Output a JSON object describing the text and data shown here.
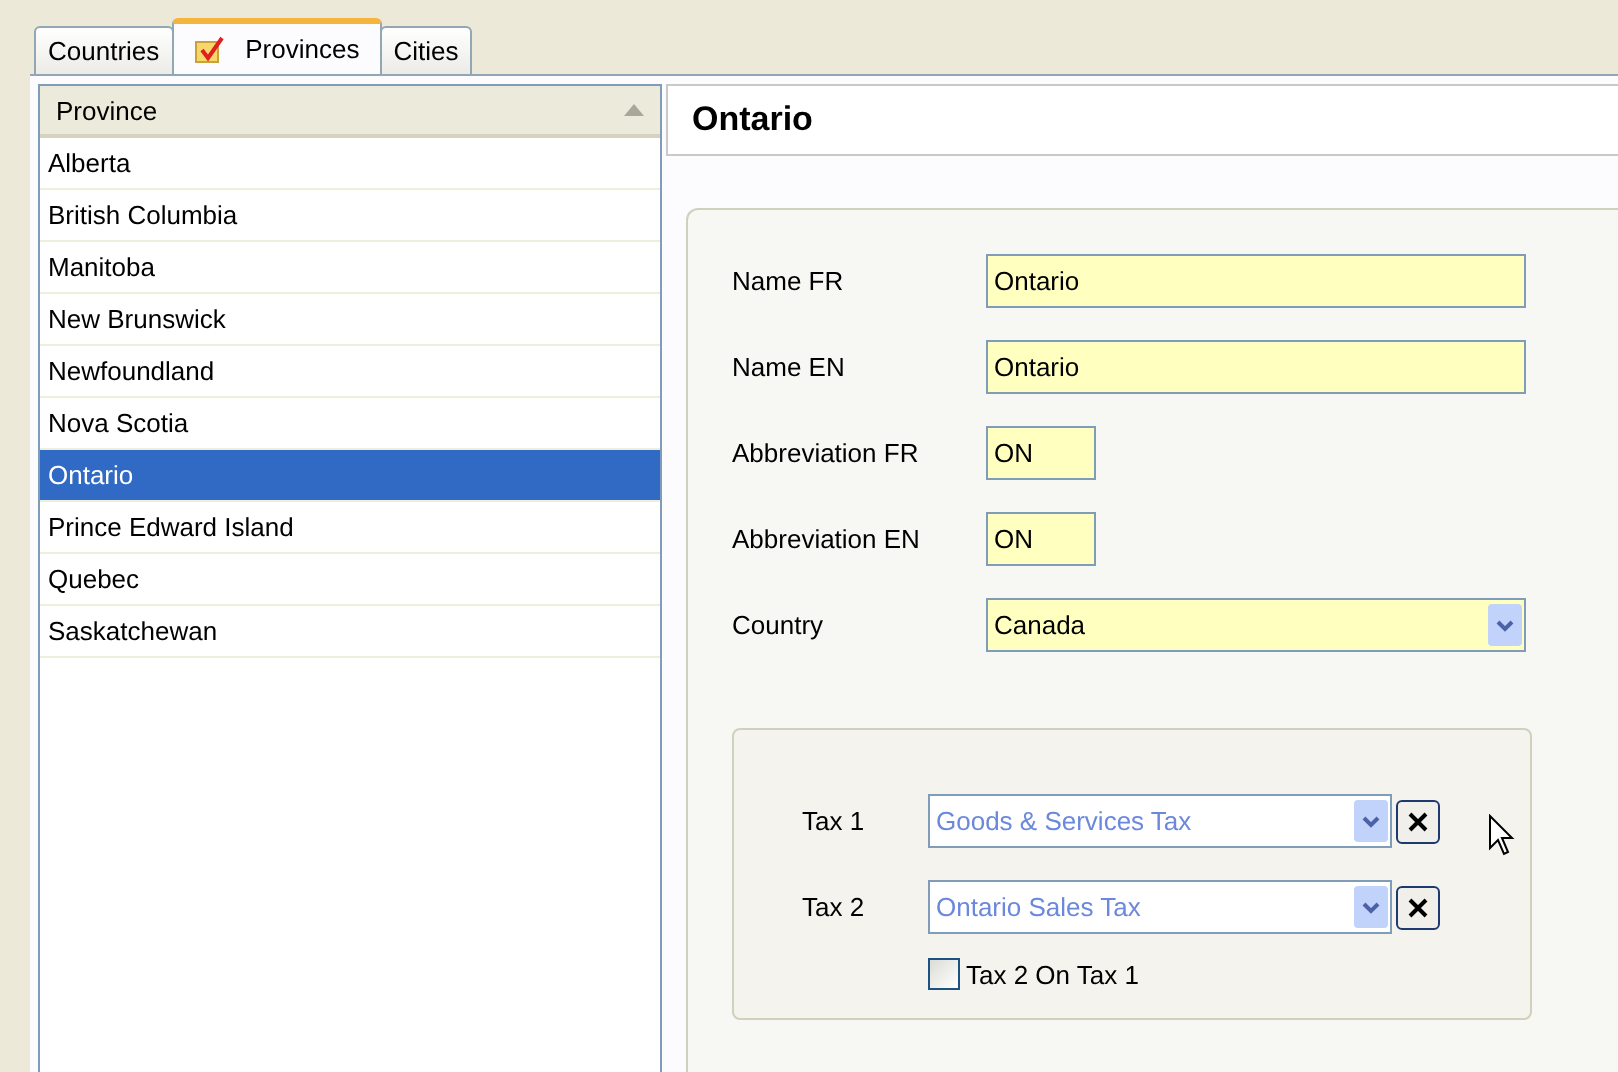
{
  "tabs": [
    {
      "label": "Countries",
      "selected": false,
      "icon": false
    },
    {
      "label": "Provinces",
      "selected": true,
      "icon": true
    },
    {
      "label": "Cities",
      "selected": false,
      "icon": false
    }
  ],
  "list": {
    "column": "Province",
    "items": [
      {
        "label": "Alberta",
        "selected": false
      },
      {
        "label": "British Columbia",
        "selected": false
      },
      {
        "label": "Manitoba",
        "selected": false
      },
      {
        "label": "New Brunswick",
        "selected": false
      },
      {
        "label": "Newfoundland",
        "selected": false
      },
      {
        "label": "Nova Scotia",
        "selected": false
      },
      {
        "label": "Ontario",
        "selected": true
      },
      {
        "label": "Prince Edward Island",
        "selected": false
      },
      {
        "label": "Quebec",
        "selected": false
      },
      {
        "label": "Saskatchewan",
        "selected": false
      }
    ]
  },
  "detail": {
    "title": "Ontario",
    "fields": [
      {
        "label": "Name FR",
        "value": "Ontario",
        "kind": "text"
      },
      {
        "label": "Name EN",
        "value": "Ontario",
        "kind": "text"
      },
      {
        "label": "Abbreviation FR",
        "value": "ON",
        "kind": "short"
      },
      {
        "label": "Abbreviation EN",
        "value": "ON",
        "kind": "short"
      },
      {
        "label": "Country",
        "value": "Canada",
        "kind": "select"
      }
    ],
    "taxes": [
      {
        "label": "Tax 1",
        "value": "Goods & Services Tax"
      },
      {
        "label": "Tax 2",
        "value": "Ontario Sales Tax"
      }
    ],
    "checkbox": {
      "label": "Tax 2 On Tax 1",
      "checked": false
    }
  }
}
